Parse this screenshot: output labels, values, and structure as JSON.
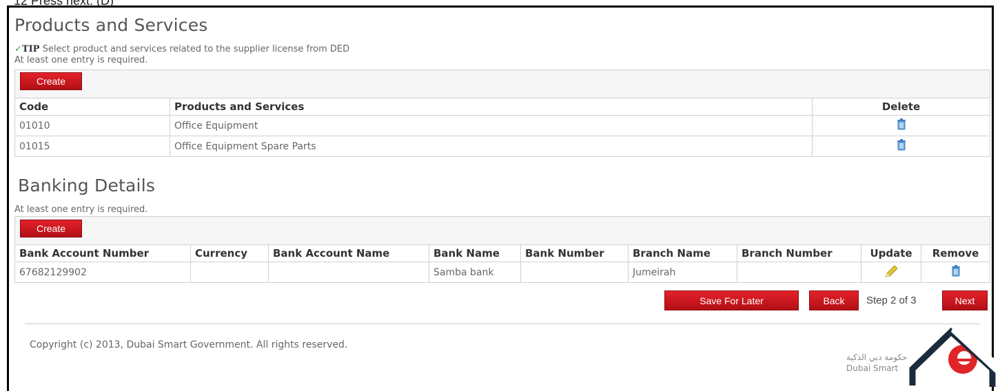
{
  "top_text": "12 Press next. (D)",
  "products": {
    "title": "Products and Services",
    "tip_label": "TIP",
    "tip_text": "Select product and services related to the supplier license from DED",
    "required_note": "At least one entry is required.",
    "create_label": "Create",
    "columns": [
      "Code",
      "Products and Services",
      "Delete"
    ],
    "rows": [
      {
        "code": "01010",
        "name": "Office Equipment"
      },
      {
        "code": "01015",
        "name": "Office Equipment Spare Parts"
      }
    ]
  },
  "banking": {
    "title": "Banking Details",
    "required_note": "At least one entry is required.",
    "create_label": "Create",
    "columns": [
      "Bank Account Number",
      "Currency",
      "Bank Account Name",
      "Bank Name",
      "Bank Number",
      "Branch Name",
      "Branch Number",
      "Update",
      "Remove"
    ],
    "rows": [
      {
        "account_number": "67682129902",
        "currency": "",
        "account_name": "",
        "bank_name": "Samba bank",
        "bank_number": "",
        "branch_name": "Jumeirah",
        "branch_number": ""
      }
    ]
  },
  "footer_nav": {
    "save_label": "Save For Later",
    "back_label": "Back",
    "step_text": "Step 2 of 3",
    "next_label": "Next"
  },
  "footer": {
    "copyright": "Copyright (c) 2013, Dubai Smart Government. All rights reserved.",
    "logo_arabic": "حكومة دبي الذكية",
    "logo_english": "Dubai Smart"
  },
  "colors": {
    "accent_red": "#d11a21",
    "trash_blue": "#4f8fc8",
    "pencil_yellow": "#e6c43a"
  }
}
